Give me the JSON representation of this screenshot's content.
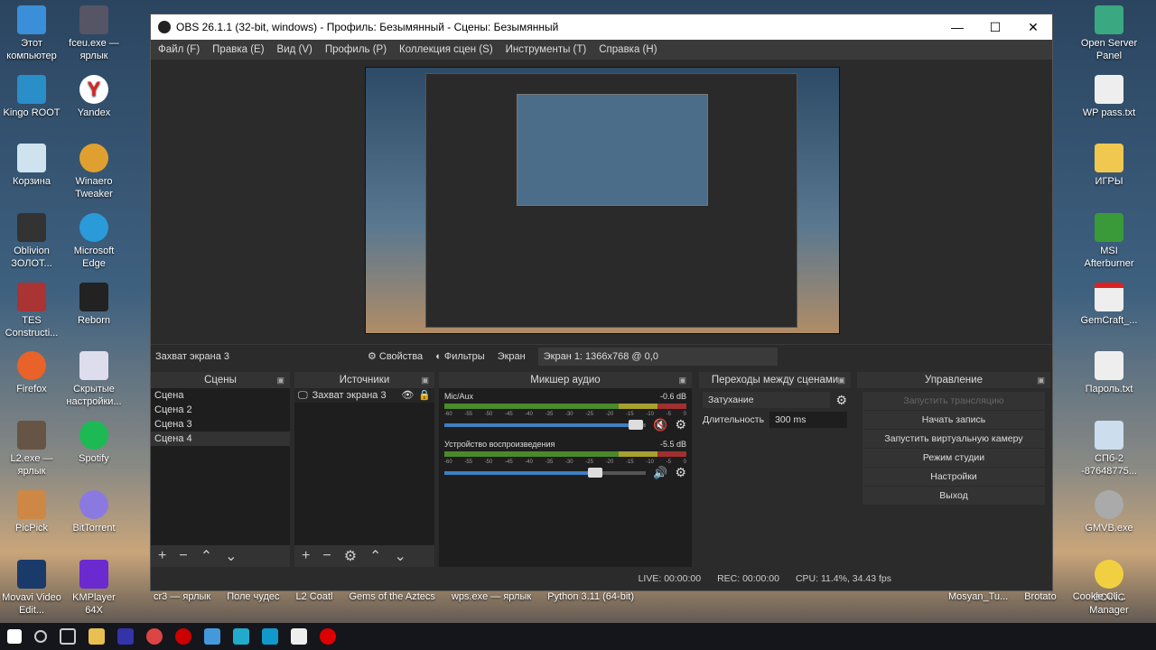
{
  "desktop": {
    "left_col1": [
      "Этот компьютер",
      "Kingo ROOT",
      "Корзина",
      "Oblivion ЗОЛОТ...",
      "TES Constructi...",
      "Firefox",
      "L2.exe — ярлык",
      "PicPick",
      "Movavi Video Edit..."
    ],
    "left_col2": [
      "fceu.exe — ярлык",
      "Yandex",
      "Winaero Tweaker",
      "Microsoft Edge",
      "Reborn",
      "Скрытые настройки...",
      "Spotify",
      "BitTorrent",
      "KMPlayer 64X"
    ],
    "right_col": [
      "Open Server Panel",
      "WP pass.txt",
      "ИГРЫ",
      "MSI Afterburner",
      "GemCraft_...",
      "Пароль.txt",
      "СПб-2 -87648775...",
      "GMVB.exe",
      "BOINC Manager"
    ],
    "bottom_row": [
      "cr3 — ярлык",
      "Поле чудес",
      "L2 Coatl",
      "Gems of the Aztecs",
      "wps.exe — ярлык",
      "Python 3.11 (64-bit)",
      "Mosyan_Tu...",
      "Brotato",
      "Cookie.Cli..."
    ]
  },
  "window": {
    "title": "OBS 26.1.1 (32-bit, windows) - Профиль: Безымянный - Сцены: Безымянный",
    "minimize": "—",
    "maximize": "☐",
    "close": "✕"
  },
  "menu": [
    "Файл (F)",
    "Правка (E)",
    "Вид (V)",
    "Профиль (P)",
    "Коллекция сцен (S)",
    "Инструменты (T)",
    "Справка (H)"
  ],
  "source_toolbar": {
    "source_name": "Захват экрана 3",
    "properties": "Свойства",
    "filters": "Фильтры",
    "screen_label": "Экран",
    "screen_value": "Экран 1: 1366x768 @ 0,0"
  },
  "scenes": {
    "title": "Сцены",
    "items": [
      "Сцена",
      "Сцена 2",
      "Сцена 3",
      "Сцена 4"
    ],
    "selected": 3
  },
  "sources": {
    "title": "Источники",
    "items": [
      "Захват экрана 3"
    ]
  },
  "mixer": {
    "title": "Микшер аудио",
    "channels": [
      {
        "name": "Mic/Aux",
        "db": "-0.6 dB",
        "volume": 0.95,
        "muted": true
      },
      {
        "name": "Устройство воспроизведения",
        "db": "-5.5 dB",
        "volume": 0.75,
        "muted": false
      }
    ],
    "ticks": [
      "-60",
      "-55",
      "-50",
      "-45",
      "-40",
      "-35",
      "-30",
      "-25",
      "-20",
      "-15",
      "-10",
      "-5",
      "0"
    ]
  },
  "transitions": {
    "title": "Переходы между сценами",
    "type": "Затухание",
    "duration_label": "Длительность",
    "duration": "300 ms"
  },
  "controls": {
    "title": "Управление",
    "buttons": [
      "Запустить трансляцию",
      "Начать запись",
      "Запустить виртуальную камеру",
      "Режим студии",
      "Настройки",
      "Выход"
    ]
  },
  "status": {
    "live": "LIVE: 00:00:00",
    "rec": "REC: 00:00:00",
    "cpu": "CPU: 11.4%, 34.43 fps"
  }
}
